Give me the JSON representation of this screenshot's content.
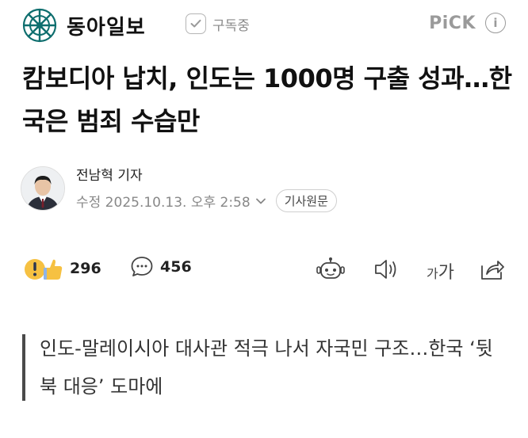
{
  "header": {
    "brand_name": "동아일보",
    "subscribe_label": "구독중",
    "pick_label": "PiCK",
    "info_label": "i"
  },
  "article": {
    "headline": "캄보디아 납치, 인도는 1000명 구출 성과…한국은 범죄 수습만",
    "reporter": "전남혁 기자",
    "date": "수정 2025.10.13. 오후 2:58",
    "original_button": "기사원문",
    "subheadline": "인도-말레이시아 대사관 적극 나서 자국민 구조…한국 ‘뒷북 대응’ 도마에"
  },
  "actions": {
    "reaction_count": "296",
    "comment_count": "456",
    "font_size_small": "가",
    "font_size_large": "가"
  },
  "colors": {
    "brand_green": "#0e6e6e",
    "muted_gray": "#888888",
    "reaction_yellow": "#f6c142"
  },
  "icons": [
    "logo-icon",
    "check-icon",
    "info-icon",
    "chevron-down-icon",
    "reaction-emoji-icon",
    "comment-icon",
    "robot-summary-icon",
    "audio-icon",
    "share-icon"
  ]
}
